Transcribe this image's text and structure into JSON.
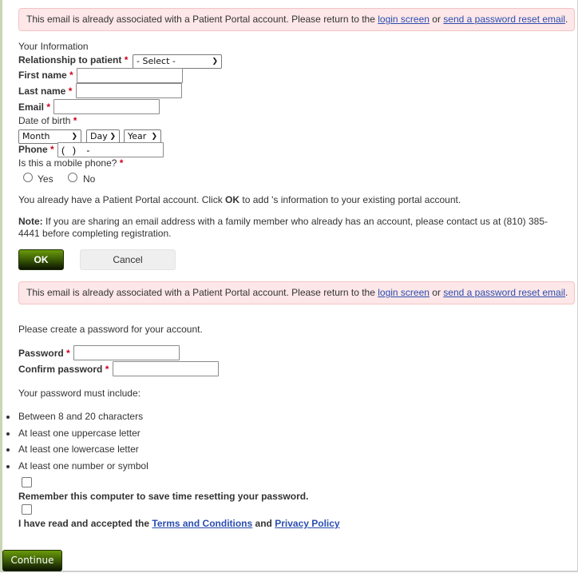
{
  "alert": {
    "text_before": "This email is already associated with a Patient Portal account. Please return to the ",
    "login_link": "login screen",
    "text_middle": " or ",
    "reset_link": "send a password reset email",
    "text_after": "."
  },
  "your_info": {
    "heading": "Your Information",
    "relationship_label": "Relationship to patient",
    "relationship_value": "- Select -",
    "first_name_label": "First name",
    "first_name_value": "",
    "last_name_label": "Last name",
    "last_name_value": "",
    "email_label": "Email",
    "email_value": "",
    "dob_label": "Date of birth",
    "dob_month": "Month",
    "dob_day": "Day",
    "dob_year": "Year",
    "phone_label": "Phone",
    "phone_value": "(   )    -",
    "mobile_question": "Is this a mobile phone?",
    "mobile_options": [
      "Yes",
      "No"
    ],
    "required_mark": "*"
  },
  "existing_account": {
    "text_before": "You already have a Patient Portal account. Click ",
    "ok_word": "OK",
    "text_after": " to add 's information to your existing portal account.",
    "note_label": "Note:",
    "note_line1": " If you are sharing an email address with a family member who already has an account, please contact us at (810) 385-",
    "note_line2": "4441 before completing registration.",
    "ok_button": "OK",
    "cancel_button": "Cancel"
  },
  "password": {
    "intro": "Please create a password for your account.",
    "password_label": "Password",
    "password_value": "",
    "confirm_label": "Confirm password",
    "confirm_value": "",
    "rules_heading": "Your password must include:",
    "rules": [
      "Between 8 and 20 characters",
      "At least one uppercase letter",
      "At least one lowercase letter",
      "At least one number or symbol"
    ],
    "remember_label": "Remember this computer to save time resetting your password.",
    "remember_checked": false,
    "terms_before": "I have read and accepted the ",
    "terms_link": "Terms and Conditions",
    "terms_middle": " and ",
    "privacy_link": "Privacy Policy",
    "terms_checked": false,
    "continue_button": "Continue"
  },
  "colors": {
    "alert_bg": "#fde7e8",
    "alert_border": "#f4c3c5",
    "link": "#2a4db0",
    "required": "#d0021b",
    "primary_button": "#3f6206"
  }
}
